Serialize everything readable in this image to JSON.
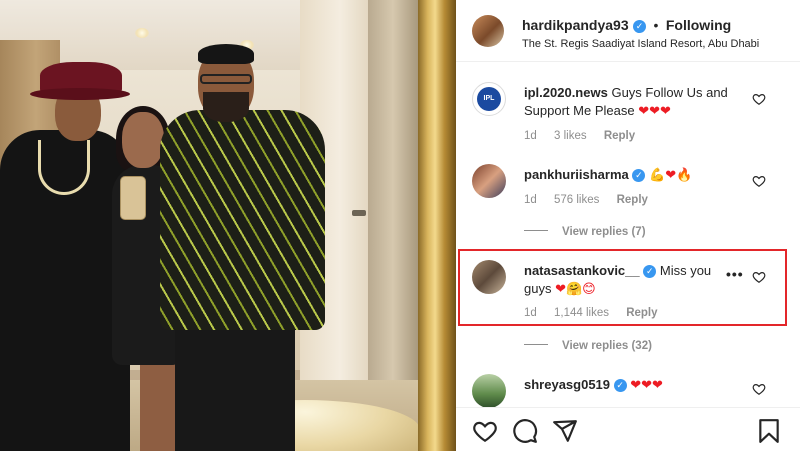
{
  "post": {
    "author": "hardikpandya93",
    "separator": "•",
    "follow_status": "Following",
    "location": "The St. Regis Saadiyat Island Resort, Abu Dhabi"
  },
  "comments": [
    {
      "username": "ipl.2020.news",
      "avatar_text": "IPL",
      "text": "Guys Follow Us and Support Me Please",
      "emoji": "❤❤❤",
      "time": "1d",
      "likes": "3 likes",
      "reply": "Reply",
      "verified": false
    },
    {
      "username": "pankhuriisharma",
      "text": "",
      "emoji": "💪❤🔥",
      "time": "1d",
      "likes": "576 likes",
      "reply": "Reply",
      "verified": true,
      "view_replies": "View replies (7)"
    },
    {
      "username": "natasastankovic__",
      "text": "Miss you guys",
      "emoji": "❤🤗😊",
      "time": "1d",
      "likes": "1,144 likes",
      "reply": "Reply",
      "verified": true,
      "more": "•••",
      "view_replies": "View replies (32)"
    },
    {
      "username": "shreyasg0519",
      "text": "",
      "emoji": "❤❤❤",
      "verified": true
    }
  ],
  "icons": {
    "heart": "heart-icon",
    "comment": "comment-icon",
    "share": "share-icon",
    "save": "bookmark-icon",
    "verified": "verified-icon",
    "more": "more-options-icon"
  },
  "colors": {
    "highlight_border": "#e3262a",
    "verified_blue": "#3897f0",
    "meta_gray": "#8e8e8e",
    "heart_red": "#ed1c24"
  }
}
